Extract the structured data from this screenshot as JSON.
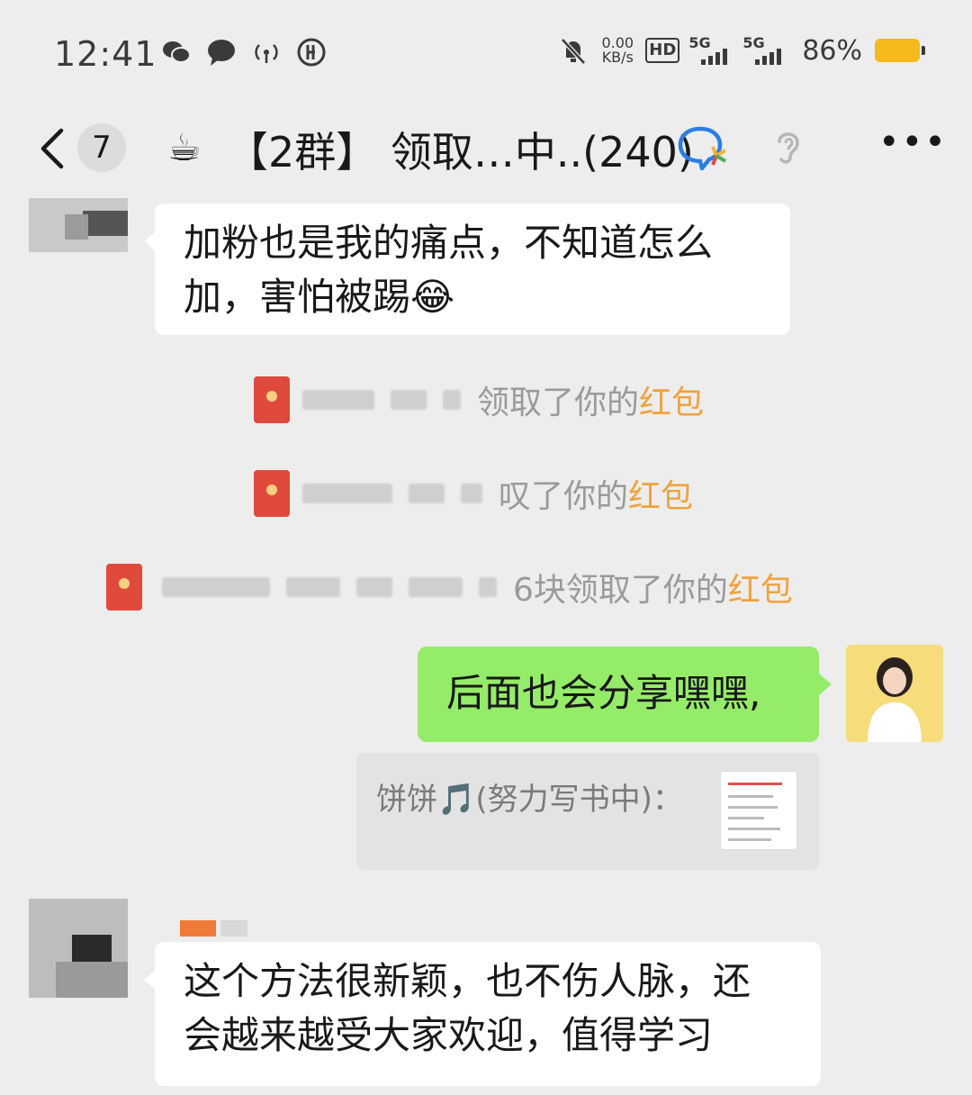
{
  "status_bar": {
    "time": "12:41",
    "net_speed_value": "0.00",
    "net_speed_unit": "KB/s",
    "hd_badge": "HD",
    "sim1_label": "5G",
    "sim2_label": "5G",
    "battery_percent": "86%",
    "battery_color": "#f5b91b"
  },
  "header": {
    "unread_count": "7",
    "group_emoji": "☕",
    "title": "【2群】 领取…中..(240)",
    "more_label": "•••"
  },
  "messages": [
    {
      "side": "left",
      "lines": [
        "加粉也是我的痛点，不知道怎么",
        "加，害怕被踢😂"
      ]
    },
    {
      "side": "right",
      "text": "后面也会分享嘿嘿,"
    },
    {
      "side": "left",
      "lines": [
        "这个方法很新颖，也不伤人脉，还",
        "会越来越受大家欢迎，值得学习"
      ]
    }
  ],
  "system_notices": [
    {
      "suffix": "领取了你的",
      "highlight": "红包"
    },
    {
      "suffix": "叹了你的",
      "highlight": "红包"
    },
    {
      "suffix": "6块领取了你的",
      "highlight": "红包"
    }
  ],
  "quote": {
    "text": "饼饼🎵(努力写书中)："
  },
  "colors": {
    "background": "#ededed",
    "bubble_self": "#95ec69",
    "bubble_other": "#ffffff",
    "red_packet": "#f0a23b"
  }
}
